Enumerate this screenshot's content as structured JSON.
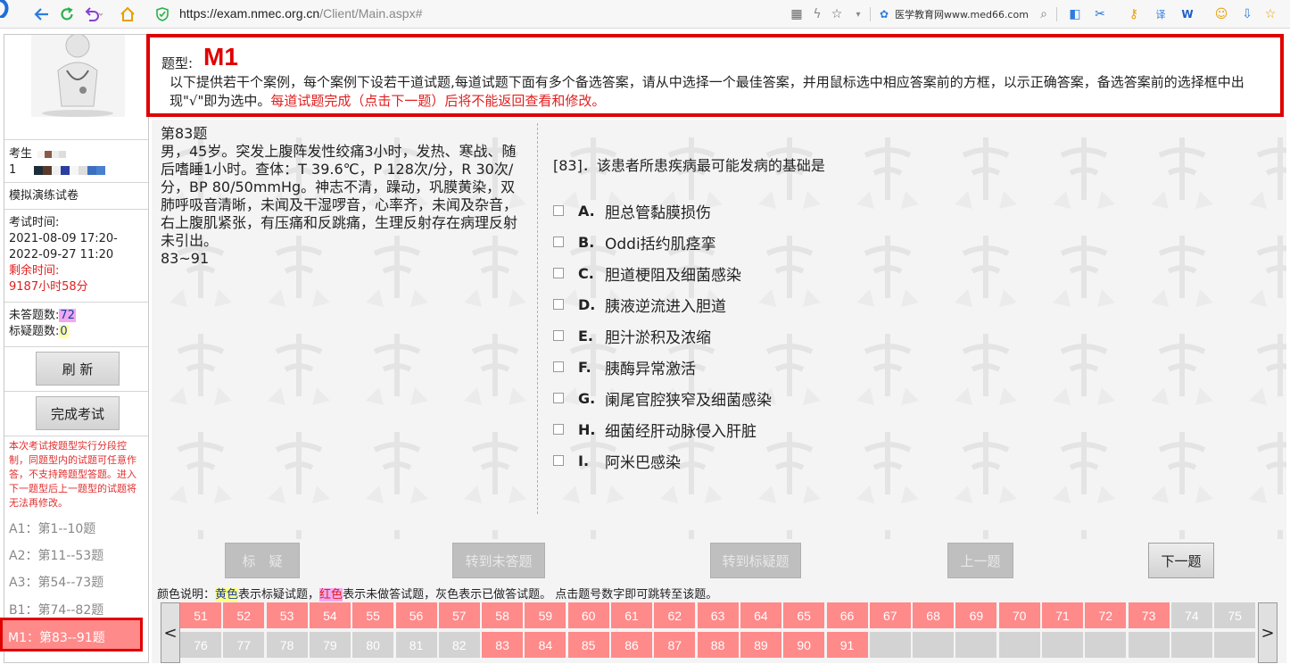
{
  "browser": {
    "url_host": "https://exam.nmec.org.cn",
    "url_path": "/Client/Main.aspx#",
    "site_label": "医学教育网www.med66.com"
  },
  "sidebar": {
    "candidate_label": "考生",
    "candidate_num": "1",
    "paper_name": "模拟演练试卷",
    "exam_time_label": "考试时间:",
    "exam_time_start": "2021-08-09 17:20-",
    "exam_time_end": "2022-09-27 11:20",
    "remaining_label": "剩余时间:",
    "remaining_value": "9187小时58分",
    "unanswered_label": "未答题数:",
    "unanswered_value": "72",
    "flagged_label": "标疑题数:",
    "flagged_value": "0",
    "refresh_button": "刷 新",
    "finish_button": "完成考试",
    "note": "本次考试按题型实行分段控制，同题型内的试题可任意作答，不支持跨题型答题。进入下一题型后上一题型的试题将无法再修改。",
    "sections": [
      {
        "label": "A1：第1--10题"
      },
      {
        "label": "A2：第11--53题"
      },
      {
        "label": "A3：第54--73题"
      },
      {
        "label": "B1：第74--82题"
      }
    ],
    "active_section": "M1：第83--91题"
  },
  "type_header": {
    "label": "题型:",
    "code": "M1",
    "description": "以下提供若干个案例，每个案例下设若干道试题,每道试题下面有多个备选答案，请从中选择一个最佳答案，并用鼠标选中相应答案前的方框，以示正确答案，备选答案前的选择框中出现\"√\"即为选中。",
    "warning": "每道试题完成（点击下一题）后将不能返回查看和修改。"
  },
  "case": {
    "title": "第83题",
    "body": "男，45岁。突发上腹阵发性绞痛3小时，发热、寒战、随后嗜睡1小时。查体：T 39.6℃，P 128次/分，R 30次/分，BP 80/50mmHg。神志不清，躁动，巩膜黄染，双肺呼吸音清晰，未闻及干湿啰音，心率齐，未闻及杂音，右上腹肌紧张，有压痛和反跳痛，生理反射存在病理反射未引出。",
    "range": "83~91"
  },
  "question": {
    "text": "[83]．该患者所患疾病最可能发病的基础是",
    "options": [
      {
        "letter": "A.",
        "text": "胆总管黏膜损伤"
      },
      {
        "letter": "B.",
        "text": "Oddi括约肌痉挛"
      },
      {
        "letter": "C.",
        "text": "胆道梗阻及细菌感染"
      },
      {
        "letter": "D.",
        "text": "胰液逆流进入胆道"
      },
      {
        "letter": "E.",
        "text": "胆汁淤积及浓缩"
      },
      {
        "letter": "F.",
        "text": "胰酶异常激活"
      },
      {
        "letter": "G.",
        "text": "阑尾官腔狭窄及细菌感染"
      },
      {
        "letter": "H.",
        "text": "细菌经肝动脉侵入肝脏"
      },
      {
        "letter": "I.",
        "text": "阿米巴感染"
      }
    ]
  },
  "actions": {
    "flag": "标　疑",
    "goto_unanswered": "转到未答题",
    "goto_flagged": "转到标疑题",
    "prev": "上一题",
    "next": "下一题"
  },
  "legend": {
    "prefix": "颜色说明：",
    "yellow_word": "黄色",
    "yellow_desc": "表示标疑试题，",
    "red_word": "红色",
    "red_desc": "表示未做答试题，",
    "gray_desc": "灰色表示已做答试题。 点击题号数字即可跳转至该题。"
  },
  "nav": {
    "left_arrow": "<",
    "right_arrow": ">",
    "row1": [
      {
        "n": "51",
        "s": "red"
      },
      {
        "n": "52",
        "s": "red"
      },
      {
        "n": "53",
        "s": "red"
      },
      {
        "n": "54",
        "s": "red"
      },
      {
        "n": "55",
        "s": "red"
      },
      {
        "n": "56",
        "s": "red"
      },
      {
        "n": "57",
        "s": "red"
      },
      {
        "n": "58",
        "s": "red"
      },
      {
        "n": "59",
        "s": "red"
      },
      {
        "n": "60",
        "s": "red"
      },
      {
        "n": "61",
        "s": "red"
      },
      {
        "n": "62",
        "s": "red"
      },
      {
        "n": "63",
        "s": "red"
      },
      {
        "n": "64",
        "s": "red"
      },
      {
        "n": "65",
        "s": "red"
      },
      {
        "n": "66",
        "s": "red"
      },
      {
        "n": "67",
        "s": "red"
      },
      {
        "n": "68",
        "s": "red"
      },
      {
        "n": "69",
        "s": "red"
      },
      {
        "n": "70",
        "s": "red"
      },
      {
        "n": "71",
        "s": "red"
      },
      {
        "n": "72",
        "s": "red"
      },
      {
        "n": "73",
        "s": "red"
      },
      {
        "n": "74",
        "s": "gray"
      },
      {
        "n": "75",
        "s": "gray"
      }
    ],
    "row2": [
      {
        "n": "76",
        "s": "gray"
      },
      {
        "n": "77",
        "s": "gray"
      },
      {
        "n": "78",
        "s": "gray"
      },
      {
        "n": "79",
        "s": "gray"
      },
      {
        "n": "80",
        "s": "gray"
      },
      {
        "n": "81",
        "s": "gray"
      },
      {
        "n": "82",
        "s": "gray"
      },
      {
        "n": "83",
        "s": "red"
      },
      {
        "n": "84",
        "s": "red"
      },
      {
        "n": "85",
        "s": "red"
      },
      {
        "n": "86",
        "s": "red"
      },
      {
        "n": "87",
        "s": "red"
      },
      {
        "n": "88",
        "s": "red"
      },
      {
        "n": "89",
        "s": "red"
      },
      {
        "n": "90",
        "s": "red"
      },
      {
        "n": "91",
        "s": "red"
      },
      {
        "n": "",
        "s": "empty"
      },
      {
        "n": "",
        "s": "empty"
      },
      {
        "n": "",
        "s": "empty"
      },
      {
        "n": "",
        "s": "empty"
      },
      {
        "n": "",
        "s": "empty"
      },
      {
        "n": "",
        "s": "empty"
      },
      {
        "n": "",
        "s": "empty"
      },
      {
        "n": "",
        "s": "empty"
      },
      {
        "n": "",
        "s": "empty"
      }
    ]
  },
  "colors": {
    "accent_red": "#e00000",
    "unanswered": "#ff8a8a",
    "answered": "#d3d3d3",
    "flagged": "#ffff80"
  }
}
